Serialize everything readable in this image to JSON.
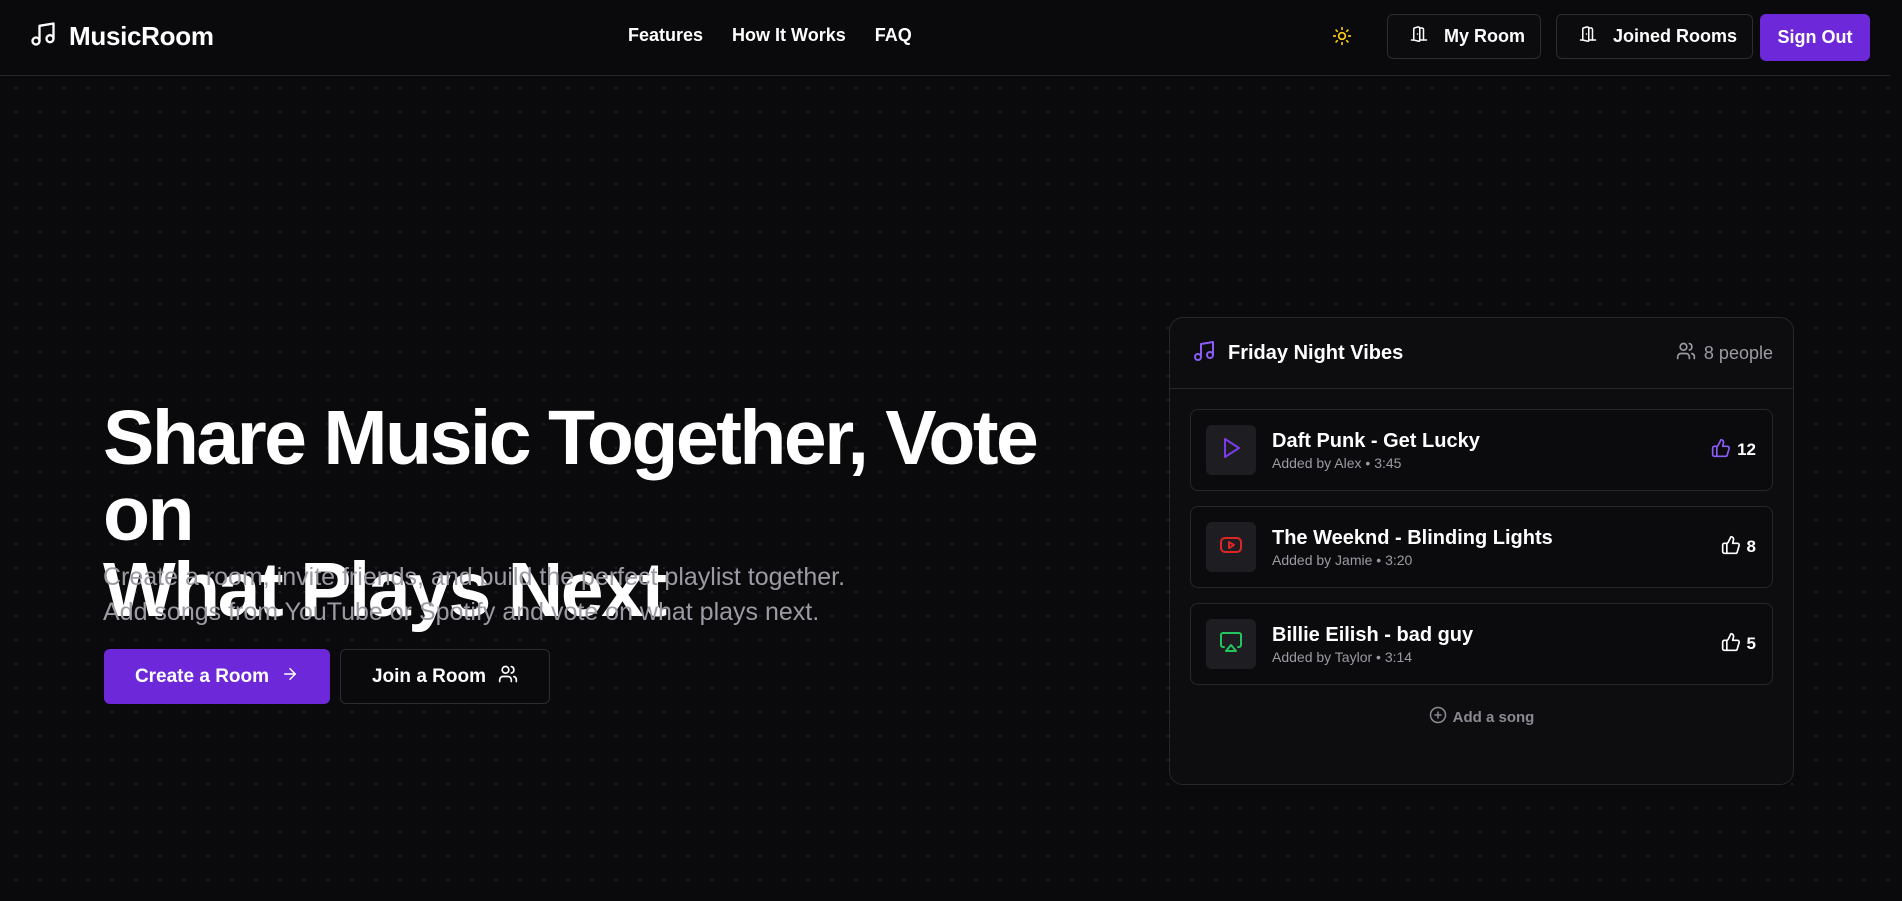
{
  "brand": {
    "name": "MusicRoom"
  },
  "nav": {
    "items": [
      {
        "label": "Features"
      },
      {
        "label": "How It Works"
      },
      {
        "label": "FAQ"
      }
    ]
  },
  "header": {
    "theme_icon": "sun-icon",
    "my_room_label": "My Room",
    "joined_rooms_label": "Joined Rooms",
    "sign_out_label": "Sign Out"
  },
  "hero": {
    "title_line1": "Share Music Together, Vote on",
    "title_line2": "What Plays Next",
    "subtitle_line1": "Create a room, invite friends, and build the perfect playlist together.",
    "subtitle_line2": "Add songs from YouTube or Spotify and vote on what plays next.",
    "create_label": "Create a Room",
    "join_label": "Join a Room"
  },
  "room_card": {
    "title": "Friday Night Vibes",
    "people": "8 people",
    "songs": [
      {
        "title": "Daft Punk - Get Lucky",
        "meta": "Added by Alex • 3:45",
        "votes": "12",
        "icon": "play-icon",
        "icon_color": "#7c3aed",
        "voted": true
      },
      {
        "title": "The Weeknd - Blinding Lights",
        "meta": "Added by Jamie • 3:20",
        "votes": "8",
        "icon": "youtube-icon",
        "icon_color": "#dc2626",
        "voted": false
      },
      {
        "title": "Billie Eilish - bad guy",
        "meta": "Added by Taylor • 3:14",
        "votes": "5",
        "icon": "airplay-icon",
        "icon_color": "#22c55e",
        "voted": false
      }
    ],
    "add_song_label": "Add a song"
  },
  "colors": {
    "accent": "#6d28d9",
    "background": "#0a0a0c",
    "muted_text": "#9b9ba3"
  }
}
